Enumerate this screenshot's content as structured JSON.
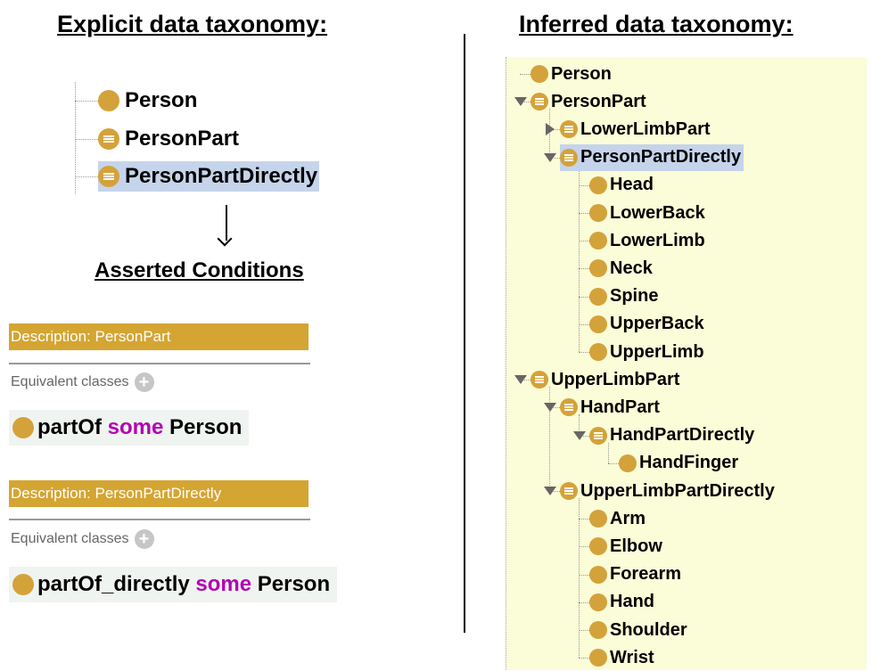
{
  "headings": {
    "explicit": "Explicit data taxonomy:",
    "inferred": "Inferred data taxonomy:",
    "asserted": "Asserted Conditions"
  },
  "explicit_tree": {
    "items": [
      {
        "label": "Person",
        "icon": "class-icon"
      },
      {
        "label": "PersonPart",
        "icon": "defined-class-icon"
      },
      {
        "label": "PersonPartDirectly",
        "icon": "defined-class-icon",
        "selected": true
      }
    ]
  },
  "descriptions": [
    {
      "title": "Description: PersonPart",
      "section": "Equivalent classes",
      "expr": {
        "property": "partOf",
        "keyword": "some",
        "filler": "Person"
      }
    },
    {
      "title": "Description: PersonPartDirectly",
      "section": "Equivalent classes",
      "expr": {
        "property": "partOf_directly",
        "keyword": "some",
        "filler": "Person"
      }
    }
  ],
  "inferred_tree": {
    "items": [
      {
        "label": "Person",
        "depth": 0,
        "icon": "class-icon",
        "toggle": "none"
      },
      {
        "label": "PersonPart",
        "depth": 0,
        "icon": "defined-class-icon",
        "toggle": "down"
      },
      {
        "label": "LowerLimbPart",
        "depth": 1,
        "icon": "defined-class-icon",
        "toggle": "right"
      },
      {
        "label": "PersonPartDirectly",
        "depth": 1,
        "icon": "defined-class-icon",
        "toggle": "down",
        "selected": true
      },
      {
        "label": "Head",
        "depth": 2,
        "icon": "class-icon",
        "toggle": "none"
      },
      {
        "label": "LowerBack",
        "depth": 2,
        "icon": "class-icon",
        "toggle": "none"
      },
      {
        "label": "LowerLimb",
        "depth": 2,
        "icon": "class-icon",
        "toggle": "none"
      },
      {
        "label": "Neck",
        "depth": 2,
        "icon": "class-icon",
        "toggle": "none"
      },
      {
        "label": "Spine",
        "depth": 2,
        "icon": "class-icon",
        "toggle": "none"
      },
      {
        "label": "UpperBack",
        "depth": 2,
        "icon": "class-icon",
        "toggle": "none"
      },
      {
        "label": "UpperLimb",
        "depth": 2,
        "icon": "class-icon",
        "toggle": "none"
      },
      {
        "label": "UpperLimbPart",
        "depth": 0,
        "icon": "defined-class-icon",
        "toggle": "down"
      },
      {
        "label": "HandPart",
        "depth": 1,
        "icon": "defined-class-icon",
        "toggle": "down"
      },
      {
        "label": "HandPartDirectly",
        "depth": 2,
        "icon": "defined-class-icon",
        "toggle": "down"
      },
      {
        "label": "HandFinger",
        "depth": 3,
        "icon": "class-icon",
        "toggle": "none"
      },
      {
        "label": "UpperLimbPartDirectly",
        "depth": 1,
        "icon": "defined-class-icon",
        "toggle": "down"
      },
      {
        "label": "Arm",
        "depth": 2,
        "icon": "class-icon",
        "toggle": "none"
      },
      {
        "label": "Elbow",
        "depth": 2,
        "icon": "class-icon",
        "toggle": "none"
      },
      {
        "label": "Forearm",
        "depth": 2,
        "icon": "class-icon",
        "toggle": "none"
      },
      {
        "label": "Hand",
        "depth": 2,
        "icon": "class-icon",
        "toggle": "none"
      },
      {
        "label": "Shoulder",
        "depth": 2,
        "icon": "class-icon",
        "toggle": "none"
      },
      {
        "label": "Wrist",
        "depth": 2,
        "icon": "class-icon",
        "toggle": "none"
      }
    ]
  },
  "colors": {
    "class_icon": "#d4a23a",
    "header_bar": "#d4a532",
    "keyword": "#b300b3",
    "selection": "#c5d4ea",
    "inferred_bg": "#fbfcd8"
  }
}
